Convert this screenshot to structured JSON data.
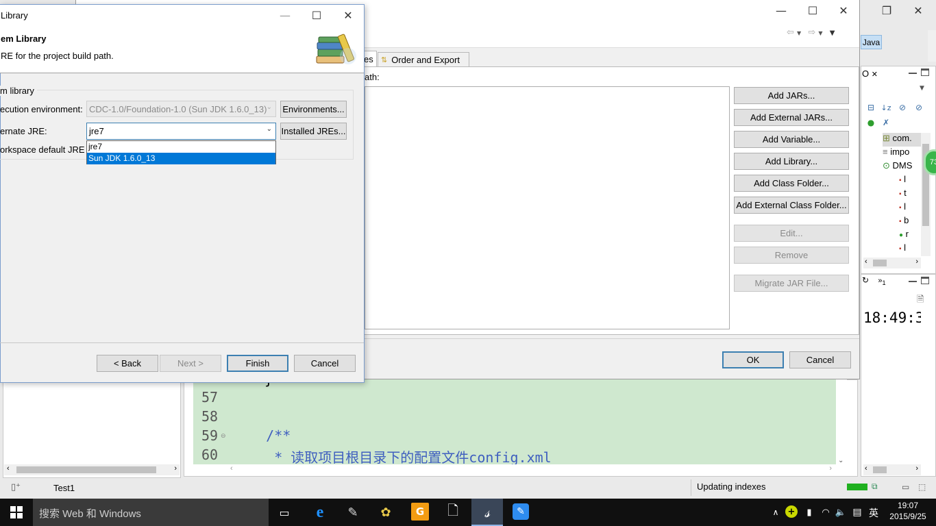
{
  "ide": {
    "perspective_label": "Java",
    "outline_tab": "O",
    "outline_items": [
      "com.",
      "impo",
      "DMS",
      "l",
      "t",
      "l",
      "b",
      "r",
      "l"
    ],
    "badge_value": "73",
    "clock_view_tab_count": "1",
    "clock_text": "18:49:3",
    "project_label": "Test1",
    "status_text": "Updating indexes",
    "code_lines": [
      {
        "num": "57",
        "text": ""
      },
      {
        "num": "58",
        "text": ""
      },
      {
        "num": "59",
        "text": "    /**"
      },
      {
        "num": "60",
        "text": "     * 读取项目根目录下的配置文件config.xml"
      }
    ],
    "code_fragment": "}"
  },
  "build_path": {
    "tab_partial": "es",
    "tab_order_export": "Order and Export",
    "path_label": "ath:",
    "buttons": {
      "add_jars": "Add JARs...",
      "add_external_jars": "Add External JARs...",
      "add_variable": "Add Variable...",
      "add_library": "Add Library...",
      "add_class_folder": "Add Class Folder...",
      "add_external_class_folder": "Add External Class Folder...",
      "edit": "Edit...",
      "remove": "Remove",
      "migrate_jar": "Migrate JAR File..."
    },
    "ok": "OK",
    "cancel": "Cancel"
  },
  "jre_dialog": {
    "window_title": "Library",
    "header_title": "em Library",
    "header_desc": "RE for the project build path.",
    "group_label": "m library",
    "exec_env_label": "ecution environment:",
    "exec_env_value": "CDC-1.0/Foundation-1.0 (Sun JDK 1.6.0_13)",
    "environments_button": "Environments...",
    "alt_jre_label": "ernate JRE:",
    "alt_jre_value": "jre7",
    "installed_jres_button": "Installed JREs...",
    "workspace_default_label": "orkspace default JRE (j",
    "dropdown_options": [
      "jre7",
      "Sun JDK 1.6.0_13"
    ],
    "dropdown_selected": "Sun JDK 1.6.0_13",
    "back": "< Back",
    "next": "Next >",
    "finish": "Finish",
    "cancel": "Cancel"
  },
  "taskbar": {
    "search_placeholder": "搜索 Web 和 Windows",
    "ime_label": "英",
    "time": "19:07",
    "date": "2015/9/25"
  }
}
